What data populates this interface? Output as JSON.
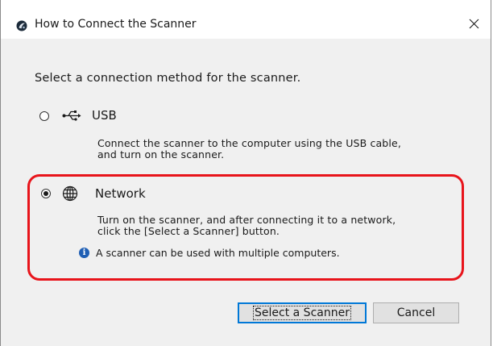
{
  "window": {
    "title": "How to Connect the Scanner",
    "close_symbol": "✕"
  },
  "prompt": "Select a connection method for the scanner.",
  "options": [
    {
      "label": "USB",
      "selected": false,
      "icon": "usb-icon",
      "description": [
        "Connect the scanner to the computer using the USB cable,",
        "and turn on the scanner."
      ]
    },
    {
      "label": "Network",
      "selected": true,
      "icon": "globe-icon",
      "description": [
        "Turn on the scanner, and after connecting it to a network,",
        "click the [Select a Scanner] button."
      ],
      "info": "A scanner can be used with multiple computers."
    }
  ],
  "buttons": {
    "select_label": "Select a Scanner",
    "cancel_label": "Cancel"
  },
  "colors": {
    "highlight": "#e8141b",
    "info_icon": "#1f5fb4",
    "focus_border": "#0078d7"
  }
}
